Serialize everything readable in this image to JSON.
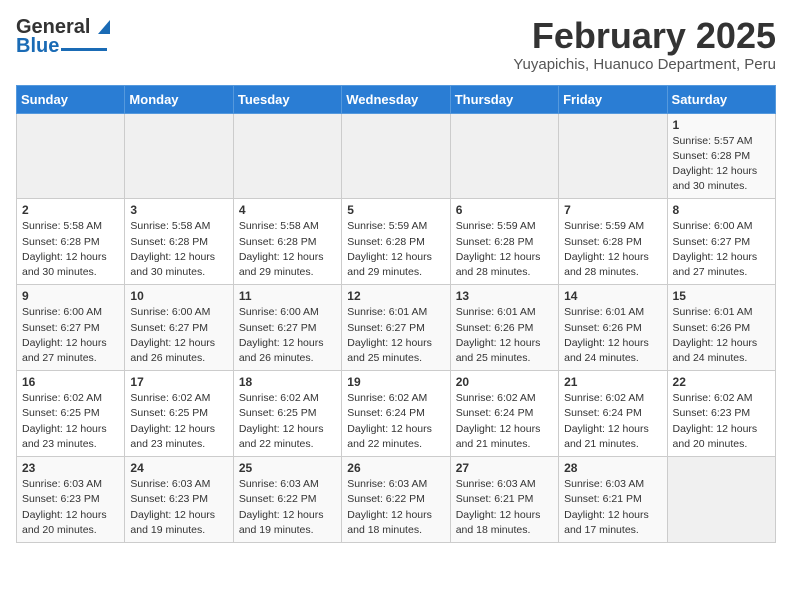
{
  "header": {
    "logo_general": "General",
    "logo_blue": "Blue",
    "month_title": "February 2025",
    "location": "Yuyapichis, Huanuco Department, Peru"
  },
  "weekdays": [
    "Sunday",
    "Monday",
    "Tuesday",
    "Wednesday",
    "Thursday",
    "Friday",
    "Saturday"
  ],
  "weeks": [
    [
      {
        "day": "",
        "info": ""
      },
      {
        "day": "",
        "info": ""
      },
      {
        "day": "",
        "info": ""
      },
      {
        "day": "",
        "info": ""
      },
      {
        "day": "",
        "info": ""
      },
      {
        "day": "",
        "info": ""
      },
      {
        "day": "1",
        "info": "Sunrise: 5:57 AM\nSunset: 6:28 PM\nDaylight: 12 hours and 30 minutes."
      }
    ],
    [
      {
        "day": "2",
        "info": "Sunrise: 5:58 AM\nSunset: 6:28 PM\nDaylight: 12 hours and 30 minutes."
      },
      {
        "day": "3",
        "info": "Sunrise: 5:58 AM\nSunset: 6:28 PM\nDaylight: 12 hours and 30 minutes."
      },
      {
        "day": "4",
        "info": "Sunrise: 5:58 AM\nSunset: 6:28 PM\nDaylight: 12 hours and 29 minutes."
      },
      {
        "day": "5",
        "info": "Sunrise: 5:59 AM\nSunset: 6:28 PM\nDaylight: 12 hours and 29 minutes."
      },
      {
        "day": "6",
        "info": "Sunrise: 5:59 AM\nSunset: 6:28 PM\nDaylight: 12 hours and 28 minutes."
      },
      {
        "day": "7",
        "info": "Sunrise: 5:59 AM\nSunset: 6:28 PM\nDaylight: 12 hours and 28 minutes."
      },
      {
        "day": "8",
        "info": "Sunrise: 6:00 AM\nSunset: 6:27 PM\nDaylight: 12 hours and 27 minutes."
      }
    ],
    [
      {
        "day": "9",
        "info": "Sunrise: 6:00 AM\nSunset: 6:27 PM\nDaylight: 12 hours and 27 minutes."
      },
      {
        "day": "10",
        "info": "Sunrise: 6:00 AM\nSunset: 6:27 PM\nDaylight: 12 hours and 26 minutes."
      },
      {
        "day": "11",
        "info": "Sunrise: 6:00 AM\nSunset: 6:27 PM\nDaylight: 12 hours and 26 minutes."
      },
      {
        "day": "12",
        "info": "Sunrise: 6:01 AM\nSunset: 6:27 PM\nDaylight: 12 hours and 25 minutes."
      },
      {
        "day": "13",
        "info": "Sunrise: 6:01 AM\nSunset: 6:26 PM\nDaylight: 12 hours and 25 minutes."
      },
      {
        "day": "14",
        "info": "Sunrise: 6:01 AM\nSunset: 6:26 PM\nDaylight: 12 hours and 24 minutes."
      },
      {
        "day": "15",
        "info": "Sunrise: 6:01 AM\nSunset: 6:26 PM\nDaylight: 12 hours and 24 minutes."
      }
    ],
    [
      {
        "day": "16",
        "info": "Sunrise: 6:02 AM\nSunset: 6:25 PM\nDaylight: 12 hours and 23 minutes."
      },
      {
        "day": "17",
        "info": "Sunrise: 6:02 AM\nSunset: 6:25 PM\nDaylight: 12 hours and 23 minutes."
      },
      {
        "day": "18",
        "info": "Sunrise: 6:02 AM\nSunset: 6:25 PM\nDaylight: 12 hours and 22 minutes."
      },
      {
        "day": "19",
        "info": "Sunrise: 6:02 AM\nSunset: 6:24 PM\nDaylight: 12 hours and 22 minutes."
      },
      {
        "day": "20",
        "info": "Sunrise: 6:02 AM\nSunset: 6:24 PM\nDaylight: 12 hours and 21 minutes."
      },
      {
        "day": "21",
        "info": "Sunrise: 6:02 AM\nSunset: 6:24 PM\nDaylight: 12 hours and 21 minutes."
      },
      {
        "day": "22",
        "info": "Sunrise: 6:02 AM\nSunset: 6:23 PM\nDaylight: 12 hours and 20 minutes."
      }
    ],
    [
      {
        "day": "23",
        "info": "Sunrise: 6:03 AM\nSunset: 6:23 PM\nDaylight: 12 hours and 20 minutes."
      },
      {
        "day": "24",
        "info": "Sunrise: 6:03 AM\nSunset: 6:23 PM\nDaylight: 12 hours and 19 minutes."
      },
      {
        "day": "25",
        "info": "Sunrise: 6:03 AM\nSunset: 6:22 PM\nDaylight: 12 hours and 19 minutes."
      },
      {
        "day": "26",
        "info": "Sunrise: 6:03 AM\nSunset: 6:22 PM\nDaylight: 12 hours and 18 minutes."
      },
      {
        "day": "27",
        "info": "Sunrise: 6:03 AM\nSunset: 6:21 PM\nDaylight: 12 hours and 18 minutes."
      },
      {
        "day": "28",
        "info": "Sunrise: 6:03 AM\nSunset: 6:21 PM\nDaylight: 12 hours and 17 minutes."
      },
      {
        "day": "",
        "info": ""
      }
    ]
  ]
}
